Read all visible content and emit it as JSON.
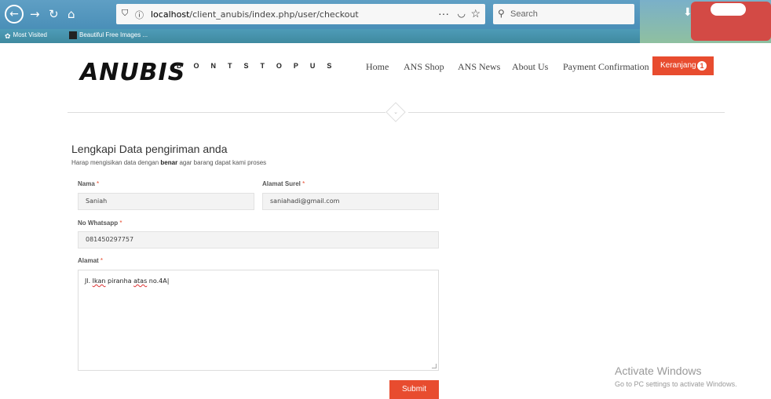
{
  "browser": {
    "url_host": "localhost",
    "url_path": "/client_anubis/index.php/user/checkout",
    "search_placeholder": "Search",
    "bookmarks": [
      "Most Visited",
      "Beautiful Free Images ..."
    ]
  },
  "header": {
    "logo": "ANUBIS",
    "tagline": "DONTSTOPUS",
    "nav": [
      "Home",
      "ANS Shop",
      "ANS News",
      "About Us",
      "Payment Confirmation"
    ],
    "cart_label": "Keranjang",
    "cart_count": "1"
  },
  "form": {
    "title": "Lengkapi Data pengiriman anda",
    "subtitle_pre": "Harap mengisikan data dengan ",
    "subtitle_bold": "benar",
    "subtitle_post": " agar barang dapat kami proses",
    "nama_label": "Nama",
    "nama_value": "Saniah",
    "email_label": "Alamat Surel",
    "email_value": "saniahadi@gmail.com",
    "wa_label": "No Whatsapp",
    "wa_value": "081450297757",
    "alamat_label": "Alamat",
    "alamat_p1": "Jl. ",
    "alamat_p2": "Ikan",
    "alamat_p3": " piranha ",
    "alamat_p4": "atas",
    "alamat_p5": " no.4A",
    "required_mark": "*",
    "submit_label": "Submit"
  },
  "watermark": {
    "line1": "Activate Windows",
    "line2": "Go to PC settings to activate Windows."
  },
  "colors": {
    "accent": "#e84c2f"
  }
}
